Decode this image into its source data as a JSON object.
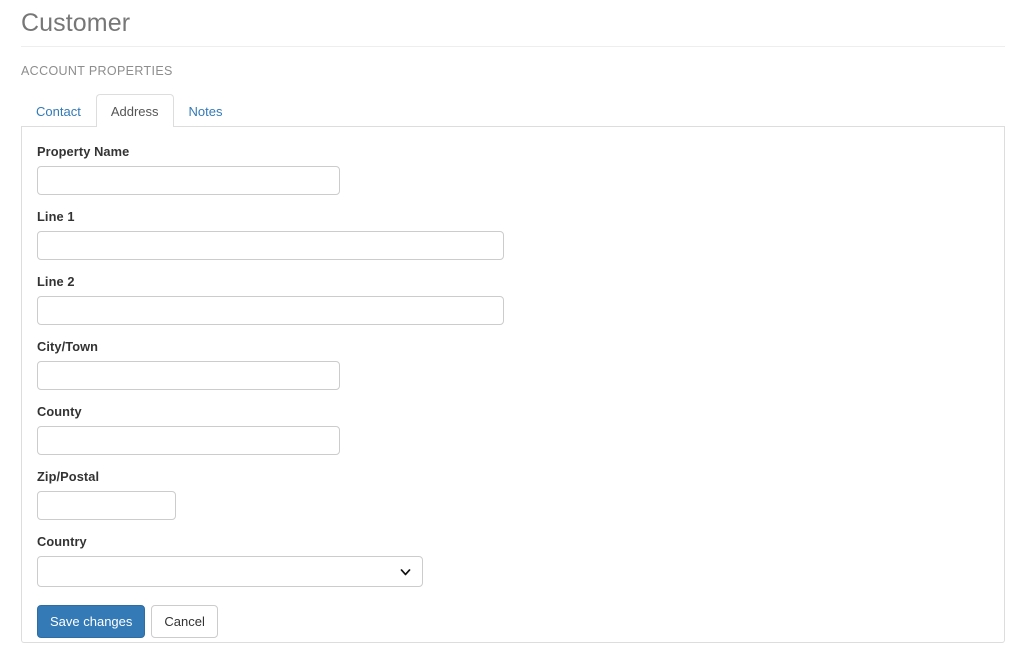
{
  "header": {
    "title": "Customer",
    "section_label": "ACCOUNT PROPERTIES"
  },
  "tabs": [
    {
      "label": "Contact",
      "active": false
    },
    {
      "label": "Address",
      "active": true
    },
    {
      "label": "Notes",
      "active": false
    }
  ],
  "form": {
    "fields": [
      {
        "label": "Property Name",
        "value": "",
        "placeholder": "",
        "type": "text",
        "width": "medium"
      },
      {
        "label": "Line 1",
        "value": "",
        "placeholder": "",
        "type": "text",
        "width": "large"
      },
      {
        "label": "Line 2",
        "value": "",
        "placeholder": "",
        "type": "text",
        "width": "large"
      },
      {
        "label": "City/Town",
        "value": "",
        "placeholder": "",
        "type": "text",
        "width": "medium"
      },
      {
        "label": "County",
        "value": "",
        "placeholder": "",
        "type": "text",
        "width": "medium"
      },
      {
        "label": "Zip/Postal",
        "value": "",
        "placeholder": "",
        "type": "text",
        "width": "small"
      },
      {
        "label": "Country",
        "value": "",
        "placeholder": "",
        "type": "select",
        "width": "select",
        "options": [
          ""
        ]
      }
    ],
    "buttons": {
      "save_label": "Save changes",
      "cancel_label": "Cancel"
    }
  },
  "icons": {
    "country_select_chevron": "chevron-down-icon"
  },
  "colors": {
    "primary": "#337ab7",
    "primary_border": "#2e6da4",
    "link": "#337ab7",
    "border": "#dddddd",
    "input_border": "#cccccc",
    "title_text": "#777777",
    "label_text": "#333333",
    "muted_text": "#8d8d8d"
  }
}
